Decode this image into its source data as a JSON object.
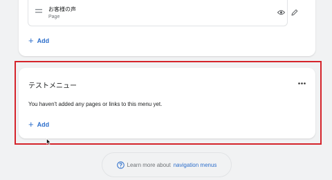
{
  "top_menu": {
    "item": {
      "title": "お客様の声",
      "type": "Page"
    },
    "add_label": "Add"
  },
  "test_menu": {
    "title": "テストメニュー",
    "empty_message": "You haven't added any pages or links to this menu yet.",
    "add_label": "Add"
  },
  "footer": {
    "learn_prefix": "Learn more about",
    "learn_link": "navigation menus"
  },
  "colors": {
    "accent": "#2c6ecb",
    "highlight": "#d5232a"
  },
  "icons": [
    "drag-handle-icon",
    "eye-icon",
    "pencil-icon",
    "plus-icon",
    "more-horizontal-icon",
    "help-circle-icon",
    "cursor-icon"
  ]
}
